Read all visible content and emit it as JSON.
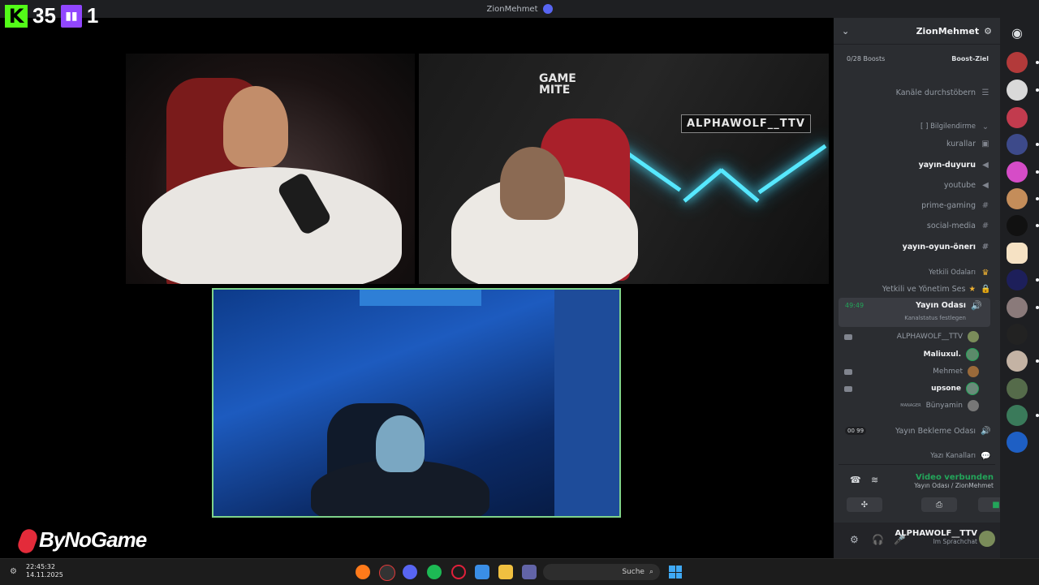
{
  "titlebar": {
    "title": "ZionMehmet"
  },
  "overlay": {
    "kick_logo": "K",
    "kick_count": "35",
    "twitch_count": "1"
  },
  "bynogame": {
    "text": "ByNoGame"
  },
  "video": {
    "sign_text": "ALPHAWOLF__TTV",
    "gamemite_line1": "GAME",
    "gamemite_line2": "MITE"
  },
  "discord": {
    "server_name": "ZionMehmet",
    "boost_label": "Boost-Ziel",
    "boost_value": "0/28 Boosts",
    "browse_channels": "Kanäle durchstöbern",
    "channels": [
      {
        "label": "[ ] Bilgilendirme",
        "type": "category"
      },
      {
        "label": "kurallar",
        "type": "text",
        "bold": false
      },
      {
        "label": "yayın-duyuru",
        "type": "announce",
        "bold": true
      },
      {
        "label": "youtube",
        "type": "announce",
        "bold": false
      },
      {
        "label": "prime-gaming",
        "type": "text",
        "bold": false
      },
      {
        "label": "social-media",
        "type": "text",
        "bold": false
      },
      {
        "label": "yayın-oyun-önerı",
        "type": "text",
        "bold": true
      },
      {
        "label": "Yetkili Odaları",
        "type": "category"
      },
      {
        "label": "Yetkili ve Yönetim Ses",
        "type": "locked",
        "bold": false
      },
      {
        "label": "Yayın Odası",
        "type": "voice",
        "bold": true,
        "timer": "49:49",
        "status": "Kanalstatus festlegen"
      }
    ],
    "voice_users": [
      {
        "name": "ALPHAWOLF__TTV",
        "bold": false,
        "muted": true
      },
      {
        "name": "Maliuxul.",
        "bold": true,
        "muted": false
      },
      {
        "name": "Mehmet",
        "bold": false,
        "muted": true
      },
      {
        "name": "upsone",
        "bold": true,
        "muted": true
      },
      {
        "name": "Bünyamin",
        "bold": false,
        "muted": false,
        "tag": "MANAGER"
      }
    ],
    "waiting_room": {
      "label": "Yayın Bekleme Odası",
      "count_a": "00",
      "count_b": "99"
    },
    "text_channels_category": "Yazı Kanalları",
    "connection": {
      "status": "Video verbunden",
      "location": "Yayın Odası / ZionMehmet"
    },
    "user": {
      "name": "ALPHAWOLF__TTV",
      "status": "Im Sprachchat"
    }
  },
  "taskbar": {
    "time": "22:45:32",
    "date": "14.11.2025",
    "search_placeholder": "Suche"
  },
  "colors": {
    "discord_bg": "#2b2d31",
    "connected_green": "#23a55a",
    "kick_green": "#53fc18",
    "twitch_purple": "#9146ff",
    "active_video_border": "#7fd38a"
  }
}
